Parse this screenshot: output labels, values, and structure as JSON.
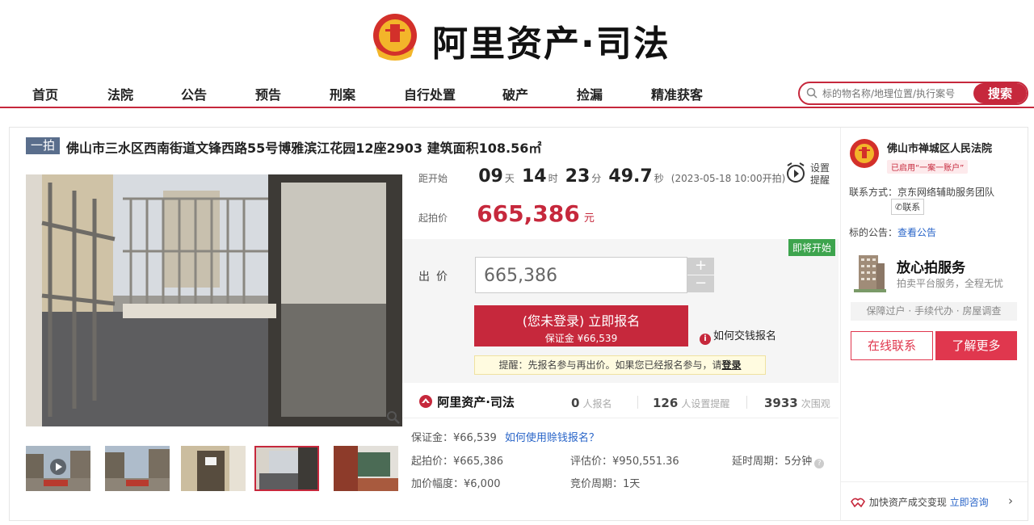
{
  "brand": {
    "logo_text": "阿里资产·司法",
    "accent": "#c6283c"
  },
  "nav": {
    "items": [
      "首页",
      "法院",
      "公告",
      "预告",
      "刑案",
      "自行处置",
      "破产",
      "捡漏",
      "精准获客"
    ]
  },
  "search": {
    "placeholder": "标的物名称/地理位置/执行案号",
    "button": "搜索",
    "icon": "search-icon"
  },
  "lot": {
    "badge": "一拍",
    "title": "佛山市三水区西南街道文锋西路55号博雅滨江花园12座2903 建筑面积108.56㎡"
  },
  "countdown": {
    "label": "距开始",
    "days": "09",
    "day_unit": "天",
    "hours": "14",
    "hour_unit": "时",
    "minutes": "23",
    "minute_unit": "分",
    "seconds": "49.7",
    "second_unit": "秒",
    "start_note": "(2023-05-18 10:00开拍)"
  },
  "reminder": {
    "line1": "设置",
    "line2": "提醒"
  },
  "start_price": {
    "label": "起拍价",
    "value": "665,386",
    "unit": "元"
  },
  "bid": {
    "status_tag": "即将开始",
    "label": "出价",
    "value": "665,386",
    "plus": "+",
    "minus": "−",
    "signup_main": "(您未登录) 立即报名",
    "signup_sub": "保证金 ¥66,539",
    "howto": "如何交钱报名",
    "tip_prefix": "提醒：先报名参与再出价。如果您已经报名参与，请",
    "tip_link": "登录"
  },
  "stats": {
    "logo": "阿里资产·司法",
    "signups": "0",
    "signups_label": "人报名",
    "reminders": "126",
    "reminders_label": "人设置提醒",
    "views": "3933",
    "views_label": "次围观"
  },
  "details": {
    "deposit": "保证金：¥66,539",
    "deposit_link": "如何使用赊钱报名？",
    "start_price": "起拍价：¥665,386",
    "appraisal": "评估价：¥950,551.36",
    "delay": "延时周期：5分钟",
    "increment": "加价幅度：¥6,000",
    "cycle": "竞价周期：1天"
  },
  "court": {
    "name": "佛山市禅城区人民法院",
    "tag": "已启用“一案一账户”",
    "contact_label": "联系方式：京东网络辅助服务团队",
    "contact_button": "联系",
    "notice_label": "标的公告：",
    "notice_link": "查看公告"
  },
  "service": {
    "title": "放心拍服务",
    "subtitle": "拍卖平台服务，全程无忧",
    "strip": "保障过户 · 手续代办 · 房屋调查",
    "btn_online": "在线联系",
    "btn_more": "了解更多",
    "speed_text": "加快资产成交变现",
    "speed_link": "立即咨询",
    "chevron": "›"
  }
}
